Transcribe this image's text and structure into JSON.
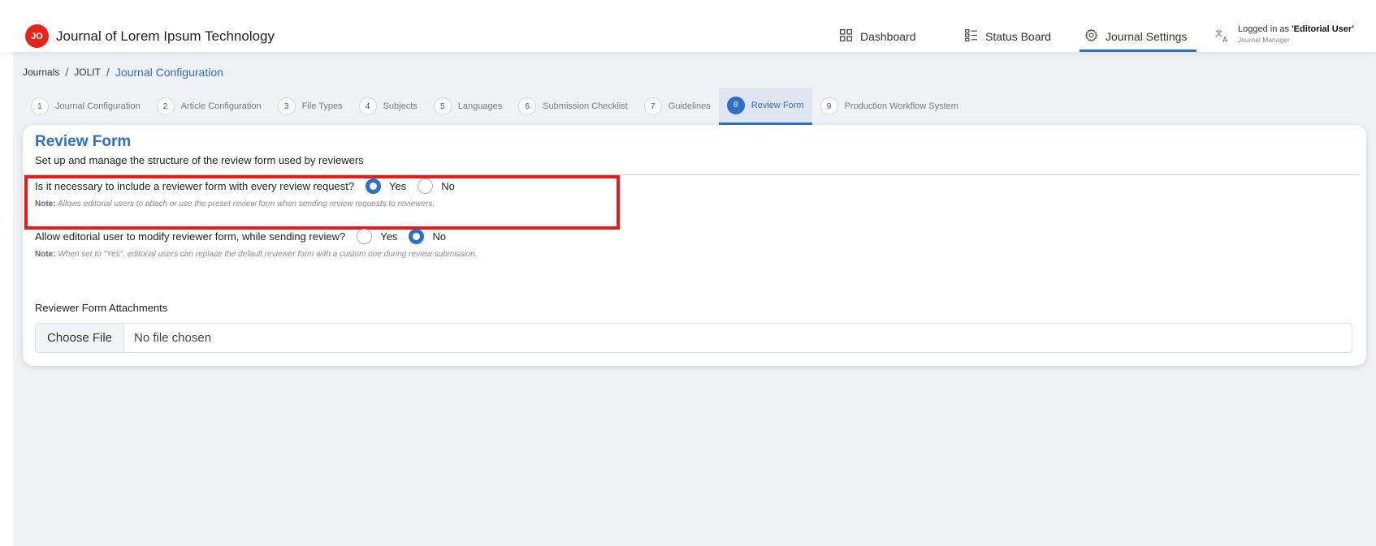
{
  "header": {
    "logo_text": "JO",
    "site_title": "Journal of Lorem Ipsum Technology",
    "nav": [
      {
        "label": "Dashboard",
        "icon": "grid-icon"
      },
      {
        "label": "Status Board",
        "icon": "board-icon"
      },
      {
        "label": "Journal Settings",
        "icon": "gear-icon",
        "active": true
      }
    ],
    "user": {
      "prefix": "Logged in as ",
      "name": "'Editorial User'",
      "role": "Journal Manager"
    }
  },
  "breadcrumb": {
    "items": [
      "Journals",
      "JOLIT",
      "Journal Configuration"
    ],
    "separator": "/"
  },
  "steps": [
    {
      "num": "1",
      "label": "Journal Configuration"
    },
    {
      "num": "2",
      "label": "Article Configuration"
    },
    {
      "num": "3",
      "label": "File Types"
    },
    {
      "num": "4",
      "label": "Subjects"
    },
    {
      "num": "5",
      "label": "Languages"
    },
    {
      "num": "6",
      "label": "Submission Checklist"
    },
    {
      "num": "7",
      "label": "Guidelines"
    },
    {
      "num": "8",
      "label": "Review Form",
      "active": true
    },
    {
      "num": "9",
      "label": "Production Workflow System"
    }
  ],
  "card": {
    "title": "Review Form",
    "subtitle": "Set up and manage the structure of the review form used by reviewers",
    "q1": {
      "question": "Is it necessary to include a reviewer form with every review request?",
      "yes": "Yes",
      "no": "No",
      "selected": "yes",
      "note_label": "Note:",
      "note_text": " Allows editorial users to attach or use the preset review form when sending review requests to reviewers."
    },
    "q2": {
      "question": "Allow editorial user to modify reviewer form, while sending review?",
      "yes": "Yes",
      "no": "No",
      "selected": "no",
      "note_label": "Note:",
      "note_text": " When set to \"Yes\", editorial users can replace the default reviewer form with a custom one during review submission."
    },
    "attachments": {
      "label": "Reviewer Form Attachments",
      "button": "Choose File",
      "status": "No file chosen"
    }
  },
  "colors": {
    "accent": "#2f6fc8",
    "logo": "#e8231a",
    "highlight": "#e41b1b"
  }
}
